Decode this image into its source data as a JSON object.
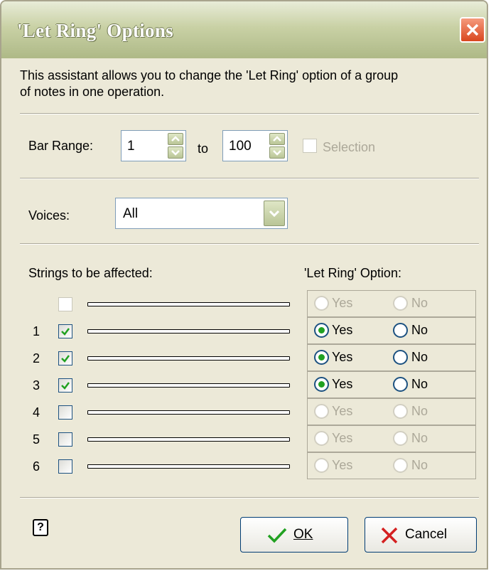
{
  "window": {
    "title": "'Let Ring' Options"
  },
  "description": "This assistant allows you to change the 'Let Ring' option of a group of notes in one operation.",
  "description_line1": "This assistant allows you to change the 'Let Ring' option of a group",
  "description_line2": "of notes in one operation.",
  "bar_range": {
    "label": "Bar Range:",
    "from": "1",
    "to_label": "to",
    "to": "100",
    "selection_label": "Selection",
    "selection_checked": false,
    "selection_enabled": false
  },
  "voices": {
    "label": "Voices:",
    "value": "All"
  },
  "strings_header": "Strings to be affected:",
  "option_header": "'Let Ring' Option:",
  "yes_label": "Yes",
  "no_label": "No",
  "strings": [
    {
      "num": "",
      "checked": false,
      "enabled": false,
      "yes": false
    },
    {
      "num": "1",
      "checked": true,
      "enabled": true,
      "yes": true
    },
    {
      "num": "2",
      "checked": true,
      "enabled": true,
      "yes": true
    },
    {
      "num": "3",
      "checked": true,
      "enabled": true,
      "yes": true
    },
    {
      "num": "4",
      "checked": false,
      "enabled": false,
      "yes": false
    },
    {
      "num": "5",
      "checked": false,
      "enabled": false,
      "yes": false
    },
    {
      "num": "6",
      "checked": false,
      "enabled": false,
      "yes": false
    }
  ],
  "buttons": {
    "ok": "OK",
    "cancel": "Cancel"
  },
  "icons": {
    "help": "help-icon",
    "ok": "checkmark-icon",
    "cancel": "x-icon",
    "close": "close-icon"
  },
  "colors": {
    "accent_green": "#21a121",
    "cancel_red": "#d42020",
    "title_bar": "#c9d1a5"
  }
}
